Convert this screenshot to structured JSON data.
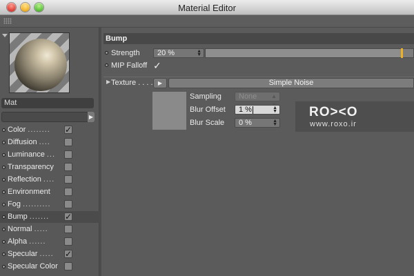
{
  "window": {
    "title": "Material Editor"
  },
  "material": {
    "name": "Mat"
  },
  "channels": [
    {
      "label": "Color",
      "dots": "........",
      "checked": true
    },
    {
      "label": "Diffusion",
      "dots": "....",
      "checked": false
    },
    {
      "label": "Luminance",
      "dots": "...",
      "checked": false
    },
    {
      "label": "Transparency",
      "dots": "",
      "checked": false
    },
    {
      "label": "Reflection",
      "dots": "....",
      "checked": false
    },
    {
      "label": "Environment",
      "dots": "",
      "checked": false
    },
    {
      "label": "Fog",
      "dots": "..........",
      "checked": false
    },
    {
      "label": "Bump",
      "dots": ".......",
      "checked": true,
      "active": true
    },
    {
      "label": "Normal",
      "dots": ".....",
      "checked": false
    },
    {
      "label": "Alpha",
      "dots": "......",
      "checked": false
    },
    {
      "label": "Specular",
      "dots": ".....",
      "checked": true
    },
    {
      "label": "Specular Color",
      "dots": "",
      "checked": false
    }
  ],
  "bump": {
    "section_title": "Bump",
    "strength_label": "Strength",
    "strength_value": "20 %",
    "strength_slider_percent": 20,
    "mip_falloff_label": "MIP Falloff",
    "mip_falloff_checked": true,
    "texture_label": "Texture . . . .",
    "texture_name": "Simple Noise",
    "sampling_label": "Sampling",
    "sampling_value": "None",
    "blur_offset_label": "Blur Offset",
    "blur_offset_value": "1 %",
    "blur_scale_label": "Blur Scale",
    "blur_scale_value": "0 %"
  },
  "watermark": {
    "logo_text": "RO><O",
    "url_text": "www.roxo.ir"
  },
  "colors": {
    "accent": "#f0b020",
    "panel_bg": "#5b5b5b",
    "header_bg": "#484848"
  },
  "icons": {
    "checkmark": "✓",
    "spinner": "▲▼",
    "arrow_right": "▶",
    "dropdown": "⌄"
  }
}
